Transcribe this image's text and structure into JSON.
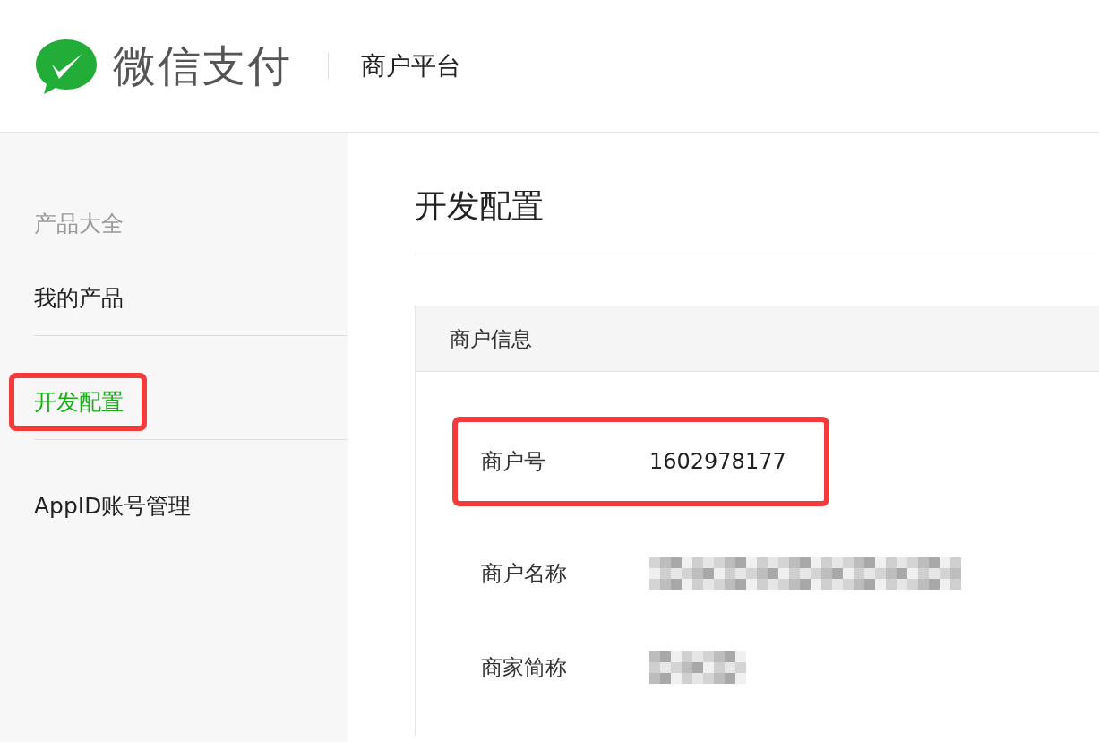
{
  "header": {
    "brand": "微信支付",
    "platform": "商户平台"
  },
  "sidebar": {
    "items": [
      {
        "kind": "heading",
        "label": "产品大全",
        "selected": false,
        "highlighted": false
      },
      {
        "kind": "link",
        "label": "我的产品",
        "selected": false,
        "highlighted": false
      },
      {
        "kind": "divider"
      },
      {
        "kind": "link",
        "label": "开发配置",
        "selected": true,
        "highlighted": true
      },
      {
        "kind": "divider"
      },
      {
        "kind": "link",
        "label": "AppID账号管理",
        "selected": false,
        "highlighted": false
      }
    ]
  },
  "page": {
    "title": "开发配置"
  },
  "card": {
    "title": "商户信息",
    "fields": [
      {
        "label": "商户号",
        "kind": "text",
        "value": "1602978177",
        "highlighted": true
      },
      {
        "label": "商户名称",
        "kind": "redacted",
        "highlighted": false
      },
      {
        "label": "商家简称",
        "kind": "redacted",
        "highlighted": false
      }
    ]
  }
}
